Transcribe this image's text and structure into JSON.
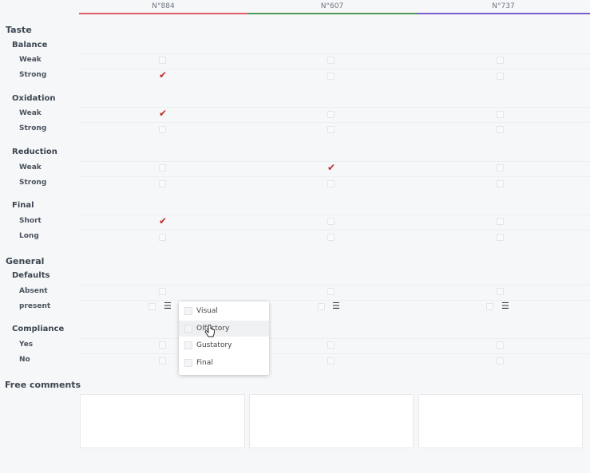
{
  "columns": [
    {
      "label": "N°884",
      "color": "#e05a6a"
    },
    {
      "label": "N°607",
      "color": "#4f9b55"
    },
    {
      "label": "N°737",
      "color": "#7a5bd0"
    }
  ],
  "sections": {
    "taste": "Taste",
    "general": "General",
    "free_comments": "Free comments"
  },
  "groups": {
    "balance": "Balance",
    "oxidation": "Oxidation",
    "reduction": "Reduction",
    "final": "Final",
    "defaults": "Defaults",
    "compliance": "Compliance"
  },
  "rows": {
    "balance_weak": "Weak",
    "balance_strong": "Strong",
    "oxidation_weak": "Weak",
    "oxidation_strong": "Strong",
    "reduction_weak": "Weak",
    "reduction_strong": "Strong",
    "final_short": "Short",
    "final_long": "Long",
    "defaults_absent": "Absent",
    "defaults_present": "present",
    "compliance_yes": "Yes",
    "compliance_no": "No"
  },
  "check_glyph": "✔",
  "list_icon_glyph": "☰",
  "checked": {
    "balance_strong": [
      true,
      false,
      false
    ],
    "oxidation_weak": [
      true,
      false,
      false
    ],
    "reduction_weak": [
      false,
      true,
      false
    ],
    "final_short": [
      true,
      false,
      false
    ]
  },
  "dropdown": {
    "items": [
      "Visual",
      "Olfactory",
      "Gustatory",
      "Final"
    ],
    "hovered": "Olfactory"
  }
}
